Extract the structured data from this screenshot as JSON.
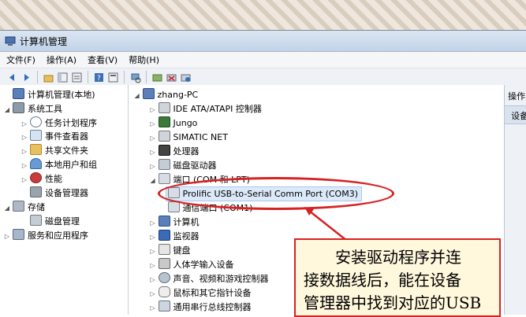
{
  "window": {
    "title": "计算机管理"
  },
  "menu": [
    "文件(F)",
    "操作(A)",
    "查看(V)",
    "帮助(H)"
  ],
  "left_tree": [
    {
      "label": "计算机管理(本地)",
      "icon": "computer-icon"
    },
    {
      "label": "系统工具",
      "icon": "tools-icon"
    },
    {
      "label": "任务计划程序",
      "icon": "clock-icon"
    },
    {
      "label": "事件查看器",
      "icon": "log-icon"
    },
    {
      "label": "共享文件夹",
      "icon": "folder-icon"
    },
    {
      "label": "本地用户和组",
      "icon": "users-icon"
    },
    {
      "label": "性能",
      "icon": "performance-icon"
    },
    {
      "label": "设备管理器",
      "icon": "device-manager-icon"
    },
    {
      "label": "存储",
      "icon": "storage-icon"
    },
    {
      "label": "磁盘管理",
      "icon": "disk-icon"
    },
    {
      "label": "服务和应用程序",
      "icon": "services-icon"
    }
  ],
  "device_tree": {
    "root": "zhang-PC",
    "items": [
      {
        "label": "IDE ATA/ATAPI 控制器"
      },
      {
        "label": "Jungo"
      },
      {
        "label": "SIMATIC NET"
      },
      {
        "label": "处理器"
      },
      {
        "label": "磁盘驱动器"
      },
      {
        "label": "端口 (COM 和 LPT)"
      },
      {
        "label": "Prolific USB-to-Serial Comm Port (COM3)"
      },
      {
        "label": "通信端口 (COM1)"
      },
      {
        "label": "计算机"
      },
      {
        "label": "监视器"
      },
      {
        "label": "键盘"
      },
      {
        "label": "人体学输入设备"
      },
      {
        "label": "声音、视频和游戏控制器"
      },
      {
        "label": "鼠标和其它指针设备"
      },
      {
        "label": "通用串行总线控制器"
      }
    ]
  },
  "action_pane": {
    "header": "操作",
    "item": "设备"
  },
  "callout": {
    "lines": [
      "安装驱动程序并连",
      "接数据线后，能在设备",
      "管理器中找到对应的USB"
    ]
  },
  "colors": {
    "callout_border": "#d62222",
    "selection": "#dbe9f9"
  }
}
